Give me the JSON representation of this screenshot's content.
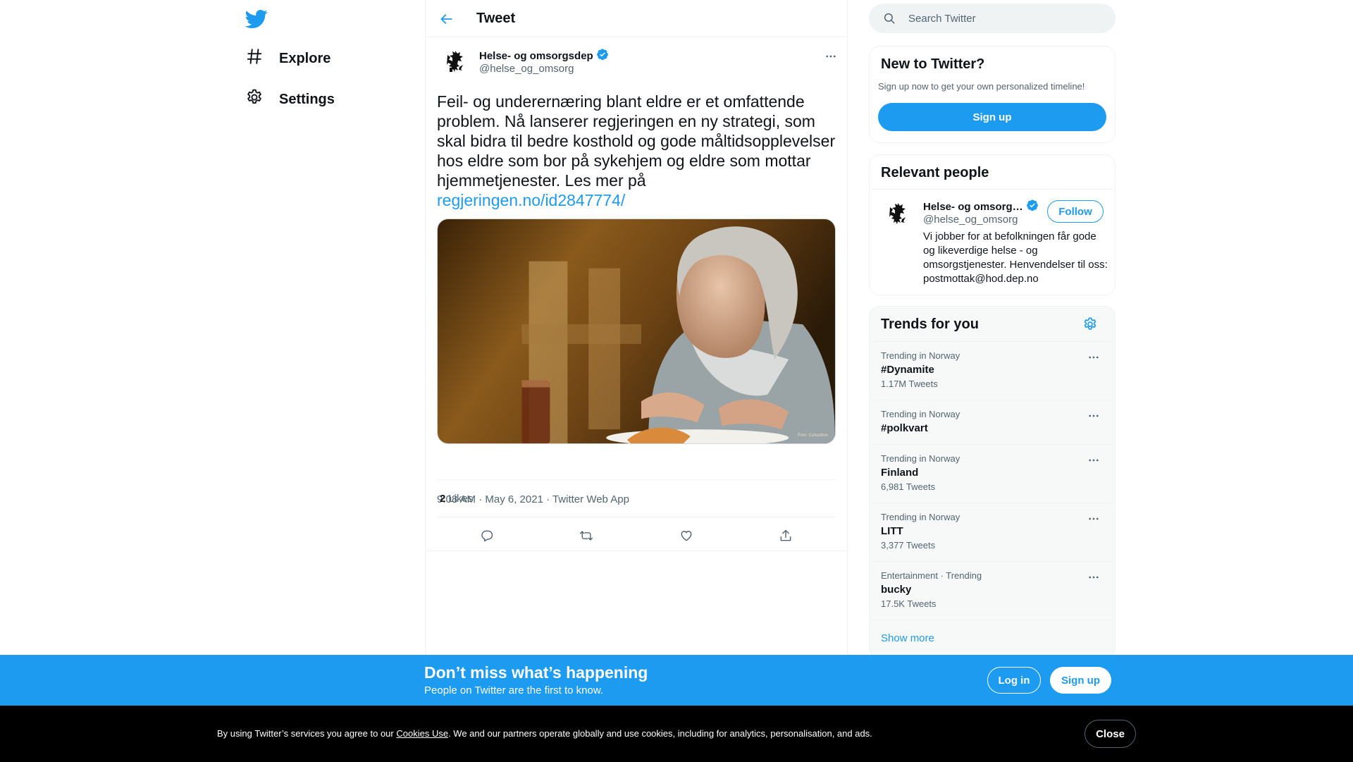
{
  "nav": {
    "logo_icon": "twitter-bird-icon",
    "items": [
      {
        "label": "Explore",
        "icon": "hashtag-icon"
      },
      {
        "label": "Settings",
        "icon": "gear-icon"
      }
    ]
  },
  "header": {
    "title": "Tweet",
    "back_icon": "back-arrow-icon"
  },
  "tweet": {
    "author_name": "Helse- og omsorgsdep",
    "author_handle": "@helse_og_omsorg",
    "text": "Feil- og underernæring blant eldre er et omfattende problem. Nå lanserer regjeringen en ny strategi, som skal bidra til bedre kosthold og gode måltidsopplevelser hos eldre som bor på sykehjem og eldre som mottar hjemmetjenester. Les mer på ",
    "link": "regjeringen.no/id2847774/",
    "photo_credit": "Foto: Colourbox",
    "meta": "9:08 AM · May 6, 2021 · Twitter Web App",
    "likes_count": "2",
    "likes_label": "Likes"
  },
  "search": {
    "placeholder": "Search Twitter"
  },
  "new_to_twitter": {
    "title": "New to Twitter?",
    "subtitle": "Sign up now to get your own personalized timeline!",
    "signup_label": "Sign up"
  },
  "relevant_people": {
    "title": "Relevant people",
    "person": {
      "name": "Helse- og omsorg…",
      "handle": "@helse_og_omsorg",
      "follow_label": "Follow",
      "bio": "Vi jobber for at befolkningen får gode og likeverdige helse - og omsorgstjenester. Henvendelser til oss: postmottak@hod.dep.no"
    }
  },
  "trends": {
    "title": "Trends for you",
    "items": [
      {
        "context": "Trending in Norway",
        "name": "#Dynamite",
        "count": "1.17M Tweets"
      },
      {
        "context": "Trending in Norway",
        "name": "#polkvart",
        "count": ""
      },
      {
        "context": "Trending in Norway",
        "name": "Finland",
        "count": "6,981 Tweets"
      },
      {
        "context": "Trending in Norway",
        "name": "LITT",
        "count": "3,377 Tweets"
      },
      {
        "context": "Entertainment · Trending",
        "name": "bucky",
        "count": "17.5K Tweets"
      }
    ],
    "show_more": "Show more"
  },
  "banner": {
    "title": "Don’t miss what’s happening",
    "subtitle": "People on Twitter are the first to know.",
    "login_label": "Log in",
    "signup_label": "Sign up"
  },
  "cookie": {
    "text_before": "By using Twitter’s services you agree to our ",
    "link": "Cookies Use",
    "text_after": ". We and our partners operate globally and use cookies, including for analytics, personalisation, and ads.",
    "close_label": "Close"
  },
  "colors": {
    "accent": "#1d9bf0",
    "text": "#0f1419",
    "secondary": "#536471"
  }
}
